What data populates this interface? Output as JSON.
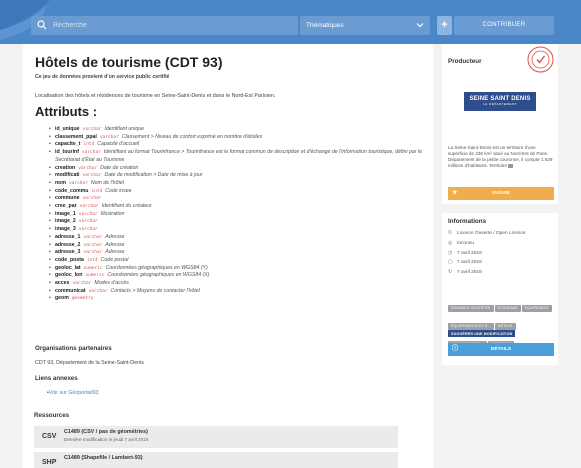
{
  "header": {
    "search_placeholder": "Recherche",
    "thematiques_label": "Thématiques",
    "plus_label": "+",
    "contribuer_label": "CONTRIBUER"
  },
  "dataset": {
    "title": "Hôtels de tourisme (CDT 93)",
    "subtitle": "Ce jeu de données provient d'un service public certifié",
    "description": "Localisation des hôtels et résidences de tourisme en Seine-Saint-Denis et dans le Nord-Est Parisien."
  },
  "attributes": {
    "heading": "Attributs :",
    "items": [
      {
        "name": "id_unique",
        "type": "varchar",
        "desc": "Identifiant unique"
      },
      {
        "name": "classement_ppal",
        "type": "varchar",
        "desc": "Classement > Niveau de confort exprimé en nombre d'étoiles"
      },
      {
        "name": "capacite_t",
        "type": "int4",
        "desc": "Capacité d'accueil"
      },
      {
        "name": "id_tourinf",
        "type": "varchar",
        "desc": "Identifiant au format Tourinfrance > Tourinfrance est le format commun de description et d'échange de l'information touristique, défini par le Secrétariat d'État au Tourisme"
      },
      {
        "name": "creation",
        "type": "varchar",
        "desc": "Date de création"
      },
      {
        "name": "modificati",
        "type": "varchar",
        "desc": "Date de modification > Date de mise à jour"
      },
      {
        "name": "nom",
        "type": "varchar",
        "desc": "Nom de l'hôtel"
      },
      {
        "name": "code_commu",
        "type": "int4",
        "desc": "Code insee"
      },
      {
        "name": "commune",
        "type": "varchar",
        "desc": ""
      },
      {
        "name": "cree_par",
        "type": "varchar",
        "desc": "Identifiant du créateur"
      },
      {
        "name": "image_1",
        "type": "varchar",
        "desc": "Illustration"
      },
      {
        "name": "image_2",
        "type": "varchar",
        "desc": ""
      },
      {
        "name": "image_3",
        "type": "varchar",
        "desc": ""
      },
      {
        "name": "adresse_1",
        "type": "varchar",
        "desc": "Adresse"
      },
      {
        "name": "adresse_2",
        "type": "varchar",
        "desc": "Adresse"
      },
      {
        "name": "adresse_3",
        "type": "varchar",
        "desc": "Adresse"
      },
      {
        "name": "code_posta",
        "type": "int4",
        "desc": "Code postal"
      },
      {
        "name": "geoloc_lat",
        "type": "numeric",
        "desc": "Coordonnées géographiques en WGS84 (Y)"
      },
      {
        "name": "geoloc_lon",
        "type": "numeric",
        "desc": "Coordonnées géographiques en WGS84 (X)"
      },
      {
        "name": "acces",
        "type": "varchar",
        "desc": "Modes d'accès"
      },
      {
        "name": "communicat",
        "type": "varchar",
        "desc": "Contacts > Moyens de contacter l'hôtel"
      },
      {
        "name": "geom",
        "type": "geometry",
        "desc": ""
      }
    ]
  },
  "partners": {
    "heading": "Organisations partenaires",
    "text": "CDT 93, Département de la Seine-Saint-Denis"
  },
  "links": {
    "heading": "Liens annexes",
    "items": [
      "Voir sur Géoportail93"
    ]
  },
  "resources": {
    "heading": "Ressources",
    "items": [
      {
        "format": "CSV",
        "name": "C1489 (CSV / pas de géométries)",
        "modified": "Dernière modification le jeudi 7 avril 2016"
      },
      {
        "format": "SHP",
        "name": "C1489 (Shapefile / Lambert-93)",
        "modified": ""
      }
    ]
  },
  "producer": {
    "heading": "Producteur",
    "logo_line1": "SEINE SAINT DENIS",
    "logo_line2": "LE DÉPARTEMENT",
    "description": "La Seine-Saint-Denis est un territoire d'une superficie de 236 km² situé au Nord-Est de Paris. Département de la petite couronne, il compte 1 529 millions d'habitants. Territoire",
    "follow_label": "SUIVRE"
  },
  "information": {
    "heading": "Informations",
    "items": [
      {
        "icon": "©",
        "text": "Licence Ouverte / Open Licence"
      },
      {
        "icon": "◎",
        "text": "Inconnu"
      },
      {
        "icon": "◷",
        "text": "7 avril 2016"
      },
      {
        "icon": "▢",
        "text": "7 avril 2016"
      },
      {
        "icon": "↻",
        "text": "7 avril 2016"
      }
    ],
    "tags": [
      "DONNÉES OUVERTES",
      "ÉCONOMIE",
      "ÉQUIPEMENT",
      "ÉQUIPEMENTS ET S...",
      "HÔTELS",
      "SEINE-SAINT-DE...",
      "TOURISME"
    ],
    "suggest_label": "SUGGÉRER UNE MODIFICATION",
    "details_label": "DÉTAILS"
  }
}
